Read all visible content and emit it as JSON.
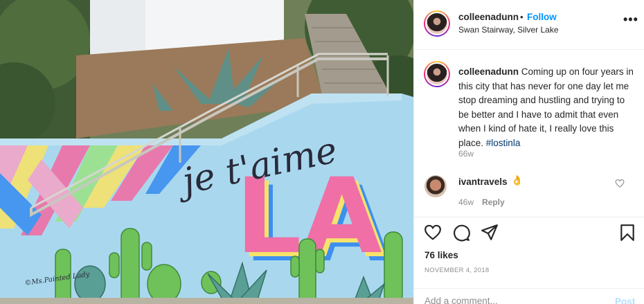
{
  "post": {
    "author": "colleenadunn",
    "separator": "•",
    "follow_label": "Follow",
    "location": "Swan Stairway, Silver Lake",
    "more_label": "•••"
  },
  "photo": {
    "mural_script": "je t'aime",
    "mural_big": "LA",
    "artist_signature": "©Ms.Painted Lady"
  },
  "caption": {
    "author": "colleenadunn",
    "text": "Coming up on four years in this city that has never for one day let me stop dreaming and hustling and trying to be better and I have to admit that even when I kind of hate it, I really love this place.",
    "hashtag": "#lostinla",
    "time": "66w"
  },
  "comment": {
    "author": "ivantravels",
    "emoji": "👌",
    "time": "46w",
    "reply_label": "Reply"
  },
  "actions": {
    "likes": "76 likes",
    "date": "NOVEMBER 4, 2018"
  },
  "add_comment": {
    "placeholder": "Add a comment...",
    "post_label": "Post"
  },
  "colors": {
    "follow": "#0095f6",
    "post_disabled": "#b2dffc",
    "wall": "#a9d8ee"
  }
}
